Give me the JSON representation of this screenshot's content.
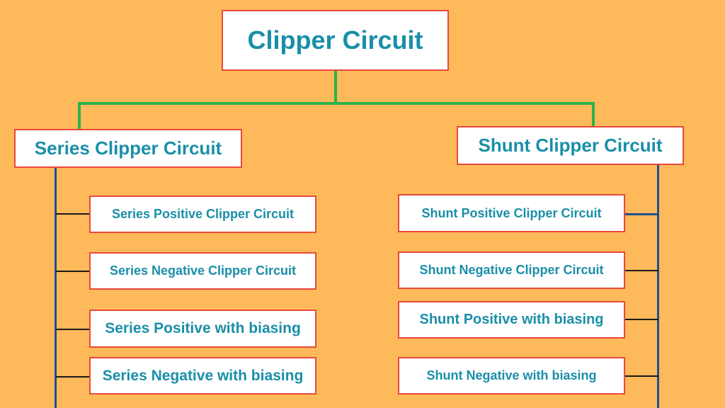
{
  "root": {
    "label": "Clipper Circuit"
  },
  "branches": {
    "series": {
      "label": "Series Clipper Circuit",
      "children": [
        "Series Positive Clipper Circuit",
        "Series Negative Clipper Circuit",
        "Series Positive with biasing",
        "Series Negative with biasing"
      ]
    },
    "shunt": {
      "label": "Shunt Clipper Circuit",
      "children": [
        "Shunt Positive Clipper Circuit",
        "Shunt Negative Clipper Circuit",
        "Shunt Positive with biasing",
        "Shunt Negative with biasing"
      ]
    }
  },
  "colors": {
    "background": "#fdb95a",
    "box_border": "#e8493c",
    "text": "#1a8fa8",
    "root_connector": "#2db34a",
    "branch_connector": "#1f4f8f",
    "leaf_connector": "#1a1a1a"
  }
}
